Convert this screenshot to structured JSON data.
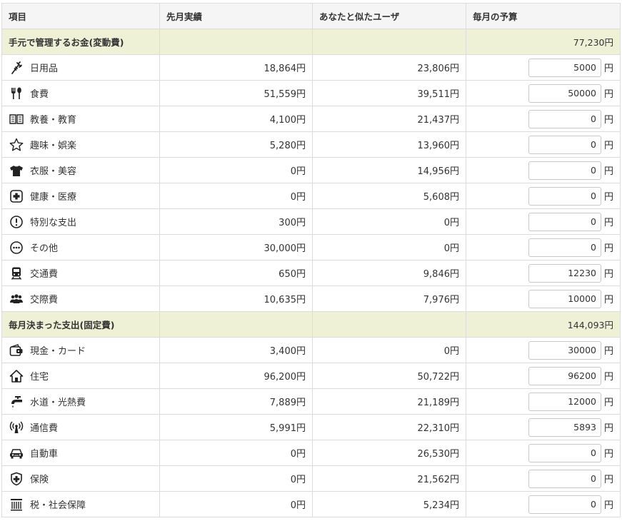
{
  "headers": [
    "項目",
    "先月実績",
    "あなたと似たユーザ",
    "毎月の予算"
  ],
  "yen": "円",
  "groups": [
    {
      "title": "手元で管理するお金(変動費)",
      "total": "77,230円",
      "rows": [
        {
          "label": "日用品",
          "icon": "daily-goods-icon",
          "last": "18,864円",
          "similar": "23,806円",
          "budget": "5000"
        },
        {
          "label": "食費",
          "icon": "fork-spoon-icon",
          "last": "51,559円",
          "similar": "39,511円",
          "budget": "50000"
        },
        {
          "label": "教養・教育",
          "icon": "book-icon",
          "last": "4,100円",
          "similar": "21,437円",
          "budget": "0"
        },
        {
          "label": "趣味・娯楽",
          "icon": "star-icon",
          "last": "5,280円",
          "similar": "13,960円",
          "budget": "0"
        },
        {
          "label": "衣服・美容",
          "icon": "shirt-icon",
          "last": "0円",
          "similar": "14,956円",
          "budget": "0"
        },
        {
          "label": "健康・医療",
          "icon": "medical-cross-icon",
          "last": "0円",
          "similar": "5,608円",
          "budget": "0"
        },
        {
          "label": "特別な支出",
          "icon": "exclamation-circle-icon",
          "last": "300円",
          "similar": "0円",
          "budget": "0"
        },
        {
          "label": "その他",
          "icon": "ellipsis-circle-icon",
          "last": "30,000円",
          "similar": "0円",
          "budget": "0"
        },
        {
          "label": "交通費",
          "icon": "train-icon",
          "last": "650円",
          "similar": "9,846円",
          "budget": "12230"
        },
        {
          "label": "交際費",
          "icon": "people-icon",
          "last": "10,635円",
          "similar": "7,976円",
          "budget": "10000"
        }
      ]
    },
    {
      "title": "毎月決まった支出(固定費)",
      "total": "144,093円",
      "rows": [
        {
          "label": "現金・カード",
          "icon": "wallet-icon",
          "last": "3,400円",
          "similar": "0円",
          "budget": "30000"
        },
        {
          "label": "住宅",
          "icon": "house-icon",
          "last": "96,200円",
          "similar": "50,722円",
          "budget": "96200"
        },
        {
          "label": "水道・光熱費",
          "icon": "faucet-icon",
          "last": "7,889円",
          "similar": "21,189円",
          "budget": "12000"
        },
        {
          "label": "通信費",
          "icon": "antenna-icon",
          "last": "5,991円",
          "similar": "22,310円",
          "budget": "5893"
        },
        {
          "label": "自動車",
          "icon": "car-icon",
          "last": "0円",
          "similar": "26,530円",
          "budget": "0"
        },
        {
          "label": "保険",
          "icon": "shield-cross-icon",
          "last": "0円",
          "similar": "21,562円",
          "budget": "0"
        },
        {
          "label": "税・社会保障",
          "icon": "pillar-icon",
          "last": "0円",
          "similar": "5,234円",
          "budget": "0"
        }
      ]
    }
  ]
}
